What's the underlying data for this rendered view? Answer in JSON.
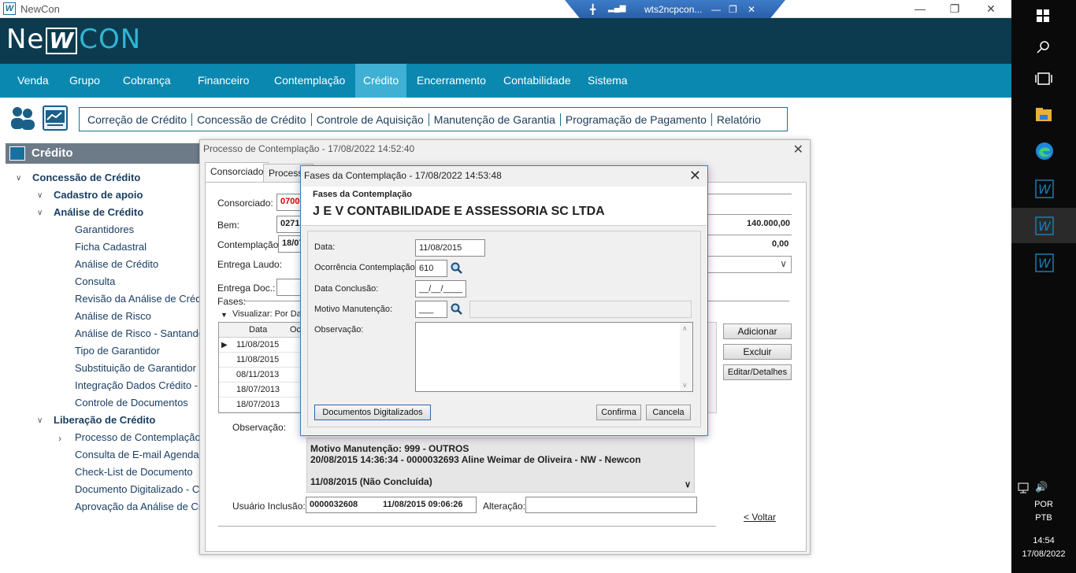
{
  "window": {
    "app_name": "NewCon",
    "rdp_host": "wts2ncpcon..."
  },
  "brand": {
    "part1": "Ne",
    "part2": "W",
    "part3": "CON"
  },
  "nav": {
    "items": [
      "Venda",
      "Grupo",
      "Cobrança",
      "Financeiro",
      "Contemplação",
      "Crédito",
      "Encerramento",
      "Contabilidade",
      "Sistema"
    ],
    "active": "Crédito"
  },
  "submenu": [
    "Correção de Crédito",
    "Concessão de Crédito",
    "Controle de Aquisição",
    "Manutenção de Garantia",
    "Programação de Pagamento",
    "Relatório"
  ],
  "sidebar": {
    "title": "Crédito",
    "items": [
      {
        "label": "Concessão de Crédito"
      },
      {
        "label": "Cadastro de apoio"
      },
      {
        "label": "Análise de Crédito"
      },
      {
        "label": "Garantidores"
      },
      {
        "label": "Ficha Cadastral"
      },
      {
        "label": "Análise de Crédito"
      },
      {
        "label": "Consulta"
      },
      {
        "label": "Revisão da Análise de Crédit"
      },
      {
        "label": "Análise de Risco"
      },
      {
        "label": "Análise de Risco - Santander"
      },
      {
        "label": "Tipo de Garantidor"
      },
      {
        "label": "Substituição de Garantidor"
      },
      {
        "label": "Integração Dados Crédito - In"
      },
      {
        "label": "Controle de Documentos"
      },
      {
        "label": "Liberação de Crédito"
      },
      {
        "label": "Processo de Contemplação"
      },
      {
        "label": "Consulta de E-mail Agendado"
      },
      {
        "label": "Check-List de Documento"
      },
      {
        "label": "Documento Digitalizado - Con"
      },
      {
        "label": "Aprovação da Análise de Créd"
      }
    ]
  },
  "main": {
    "title": "Processo de Contemplação - 17/08/2022  14:52:40",
    "tabs": [
      "Consorciado",
      "Processo"
    ],
    "consorciado_label": "Consorciado:",
    "consorciado_value": "0700",
    "bem_label": "Bem:",
    "bem_value": "0271",
    "bem_amount": "140.000,00",
    "contemplacao_label": "Contemplação:",
    "contemplacao_value": "18/07",
    "contemplacao_amount": "0,00",
    "entrega_laudo_label": "Entrega Laudo:",
    "entrega_doc_label": "Entrega Doc.:",
    "fases_label": "Fases:",
    "visualizar_label": "Visualizar: Por Dat",
    "grid_headers": [
      "Data",
      "Oc"
    ],
    "grid_rows": [
      "11/08/2015",
      "11/08/2015",
      "08/11/2013",
      "18/07/2013",
      "18/07/2013"
    ],
    "buttons": {
      "adicionar": "Adicionar",
      "excluir": "Excluir",
      "editar": "Editar/Detalhes",
      "voltar": "< Voltar"
    },
    "observacao_label": "Observação:",
    "obs_lines": [
      "Motivo Manutenção: 999 - OUTROS",
      "20/08/2015 14:36:34 - 0000032693 Aline Weimar de Oliveira - NW - Newcon",
      "",
      "11/08/2015 (Não Concluída)"
    ],
    "usuario_inclusao_label": "Usuário Inclusão:",
    "usuario_inclusao_value": "0000032608",
    "usuario_inclusao_date": "11/08/2015 09:06:26",
    "alteracao_label": "Alteração:"
  },
  "dialog": {
    "title": "Fases da Contemplação - 17/08/2022  14:53:48",
    "header_small": "Fases da Contemplação",
    "header_big": "J E V CONTABILIDADE E ASSESSORIA SC LTDA",
    "data_label": "Data:",
    "data_value": "11/08/2015",
    "ocorrencia_label": "Ocorrência Contemplação:",
    "ocorrencia_value": "610",
    "conclusao_label": "Data Conclusão:",
    "conclusao_value": "__/__/____",
    "motivo_label": "Motivo Manutenção:",
    "motivo_value": "___",
    "observacao_label": "Observação:",
    "btn_docs": "Documentos Digitalizados",
    "btn_confirma": "Confirma",
    "btn_cancela": "Cancela"
  },
  "taskbar": {
    "lang1": "POR",
    "lang2": "PTB",
    "time": "14:54",
    "date": "17/08/2022"
  }
}
